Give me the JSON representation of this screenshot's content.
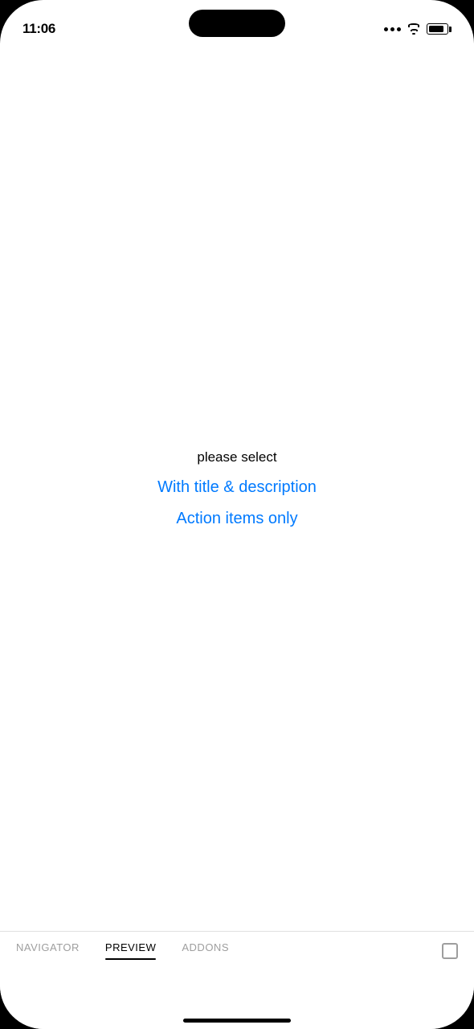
{
  "statusBar": {
    "time": "11:06"
  },
  "mainContent": {
    "pleaseSelect": "please select",
    "option1": "With title & description",
    "option2": "Action items only"
  },
  "tabBar": {
    "tabs": [
      {
        "label": "NAVIGATOR",
        "active": false
      },
      {
        "label": "PREVIEW",
        "active": true
      },
      {
        "label": "ADDONS",
        "active": false
      }
    ]
  },
  "colors": {
    "accent": "#007AFF",
    "text": "#000000",
    "tabInactive": "#9e9e9e"
  }
}
